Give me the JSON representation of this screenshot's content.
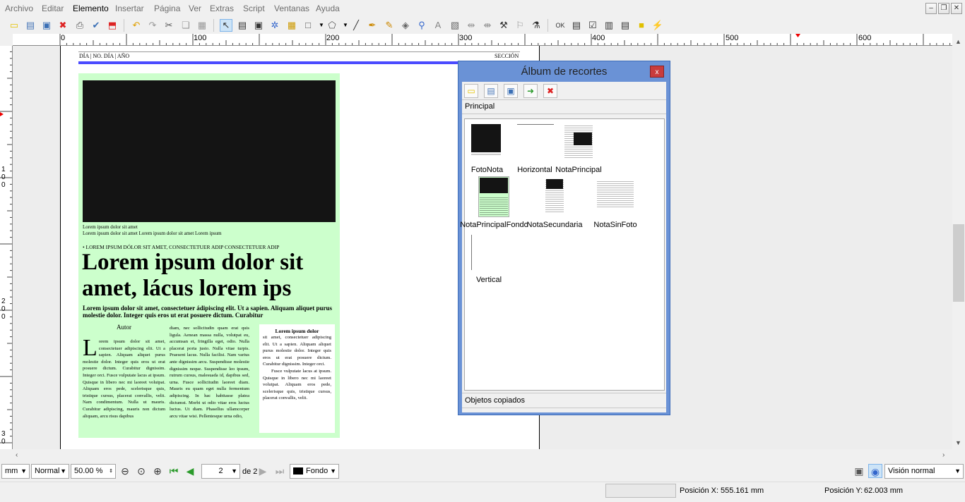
{
  "menu": [
    "Archivo",
    "Editar",
    "Elemento",
    "Insertar",
    "Página",
    "Ver",
    "Extras",
    "Script",
    "Ventanas",
    "Ayuda"
  ],
  "ruler": {
    "h_labels": [
      "0",
      "100",
      "200",
      "300",
      "400",
      "500",
      "600"
    ],
    "v_labels": [
      "1 0 0",
      "2 0 0",
      "3 0"
    ]
  },
  "page": {
    "header_left": "DÍA | NO. DÍA | AÑO",
    "header_right": "SECCIÓN",
    "caption1": "Lorem ipsum dolor sit amet",
    "caption2": "Lorem ipsum dolor sit amet Lorem ipsum dolor sit amet Lorem ipsum",
    "kicker": "• LOREM IPSUM DÓLOR SIT AMET, CONSECTETUER ADIP CONSECTETUER ADIP",
    "headline": "Lorem ipsum dolor sit amet, lácus lorem ips",
    "subhead": "Lorem ipsum dolor sit amet, consectetuer ádipiscing elit. Ut a sapien. Aliquam aliquet purus molestie dolor. Integer quis eros ut erat posuere dictum. Curabitur",
    "author": "Autor",
    "dropcap": "L",
    "col1": "orem ipsum dolor sit amet, consectetuer adipiscing elit. Ut a sapien. Aliquam aliquet purus molestie dolor. Integer quis eros ut erat posuere dictum. Curabitur dignissim. Integer orci. Fusce vulputate lacus at ipsum. Quisque in libero nec mi laoreet volutpat. Aliquam eros pede, scelerisque quis, tristique cursus, placerat convallis, velit. Nam condimentum. Nulla ut mauris. Curabitur adipiscing, mauris non dictum aliquam, arcu risus dapibus",
    "col2": "diam, nec sollicitudin quam erat quis ligula. Aenean massa nulla, volutpat eu, accumsan et, fringilla eget, odio. Nulla placerat porta justo. Nulla vitae turpis. Praesent lacus. Nulla facilisi. Nam varius ante dignissim arcu. Suspendisse molestie dignissim neque. Suspendisse leo ipsum, rutrum cursus, malesuada id, dapibus sed, urna. Fusce sollicitudin laoreet diam. Mauris eu quam eget nulla fermentum adipiscing. In hac habitasse platea dictumst. Morbi ut odio vitae eros luctus luctus. Ut diam. Phasellus ullamcorper arcu vitae wisi. Pellentesque urna odio,",
    "box_title": "Lorem ipsum dolor",
    "box_text1": "sit amet, consectetuer adipiscing elit. Ut a sapien. Aliquam aliquet purus molestie dolor. Integer quis eros ut erat posuere dictum. Curabitur dignissim. Integer orci.",
    "box_text2": "Fusce vulputate lacus at ipsum. Quisque in libero nec mi laoreet volutpat. Aliquam eros pede, scelerisque quis, tristique cursus, placerat convallis, velit."
  },
  "scrapbook": {
    "title": "Álbum de recortes",
    "close": "x",
    "section_top": "Principal",
    "section_bottom": "Objetos copiados",
    "items": [
      "FotoNota",
      "Horizontal",
      "NotaPrincipal",
      "NotaPrincipalFondo",
      "NotaSecundaria",
      "NotaSinFoto",
      "Vertical"
    ]
  },
  "bottom": {
    "unit": "mm",
    "mode": "Normal",
    "zoom": "50.00 %",
    "page_num": "2",
    "page_of": "de 2",
    "layer": "Fondo",
    "view": "Visión normal"
  },
  "status": {
    "pos_x_label": "Posición X:",
    "pos_x": "555.161 mm",
    "pos_y_label": "Posición Y:",
    "pos_y": "62.003 mm"
  },
  "colors": {
    "page_bg_green": "#ccffcc",
    "accent_line": "#4b4bff",
    "scrap_frame": "#6a92d6"
  }
}
